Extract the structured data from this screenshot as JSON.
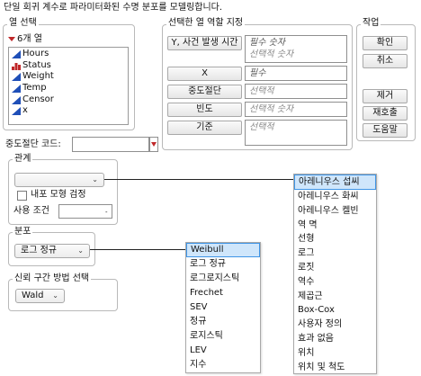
{
  "header": {
    "description": "단일 회귀 계수로 파라미터화된 수명 분포를 모델링합니다."
  },
  "column_selection": {
    "title": "열 선택",
    "count_label": "6개 열",
    "items": [
      {
        "label": "Hours",
        "icon": "continuous-icon",
        "color": "#1f4fb8"
      },
      {
        "label": "Status",
        "icon": "nominal-icon",
        "color": "#c0282a"
      },
      {
        "label": "Weight",
        "icon": "continuous-icon",
        "color": "#1f4fb8"
      },
      {
        "label": "Temp",
        "icon": "continuous-icon",
        "color": "#1f4fb8"
      },
      {
        "label": "Censor",
        "icon": "continuous-icon",
        "color": "#1f4fb8"
      },
      {
        "label": "x",
        "icon": "continuous-icon",
        "color": "#1f4fb8"
      }
    ]
  },
  "roles": {
    "title": "선택한 열 역할 지정",
    "y_button": "Y, 사건 발생 시간",
    "y_required": "필수 숫자",
    "y_optional": "선택적 숫자",
    "x_button": "X",
    "x_required": "필수",
    "censor_button": "중도절단",
    "censor_hint": "선택적",
    "freq_button": "빈도",
    "freq_hint": "선택적 숫자",
    "by_button": "기준",
    "by_hint": "선택적"
  },
  "actions": {
    "title": "작업",
    "ok": "확인",
    "cancel": "취소",
    "remove": "제거",
    "recall": "재호출",
    "help": "도움말"
  },
  "censor_code": {
    "label": "중도절단 코드:",
    "value": ""
  },
  "relationship": {
    "title": "관계",
    "selected": "",
    "pure_model_check": "내포 모형 검정",
    "use_condition_label": "사용 조건",
    "use_condition_value": ""
  },
  "distribution": {
    "title": "분포",
    "selected": "로그 정규"
  },
  "confidence": {
    "title": "신뢰 구간 방법 선택",
    "selected": "Wald"
  },
  "relationship_menu": {
    "items": [
      "아레니우스 섭씨",
      "아레니우스 화씨",
      "아레니우스 켈빈",
      "역 멱",
      "선형",
      "로그",
      "로짓",
      "역수",
      "제곱근",
      "Box-Cox",
      "사용자 정의",
      "효과 없음",
      "위치",
      "위치 및 척도"
    ],
    "highlighted_index": 0
  },
  "distribution_menu": {
    "items": [
      "Weibull",
      "로그 정규",
      "로그로지스틱",
      "Frechet",
      "SEV",
      "정규",
      "로지스틱",
      "LEV",
      "지수"
    ],
    "highlighted_index": 0
  },
  "colors": {
    "highlight_bg": "#cfe6fb",
    "highlight_border": "#3f95e6",
    "accent_red": "#c0282a",
    "continuous_blue": "#1f4fb8"
  }
}
